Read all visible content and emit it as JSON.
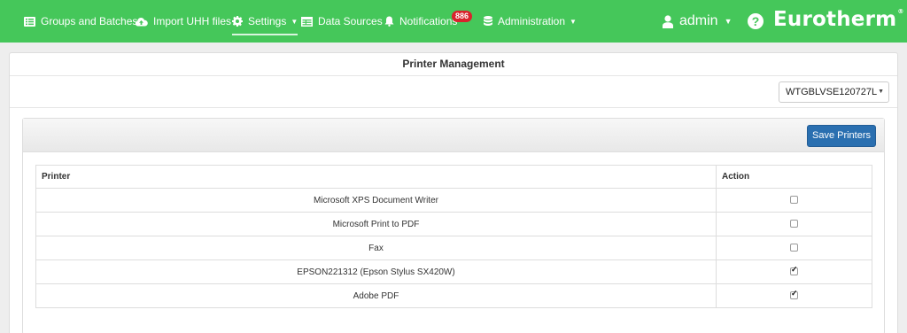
{
  "nav": {
    "groups_batches": "Groups and Batches",
    "import_uhh": "Import UHH files",
    "settings": "Settings",
    "data_sources": "Data Sources",
    "notifications": "Notifications",
    "notifications_count": "886",
    "administration": "Administration",
    "user": "admin",
    "help": "?",
    "brand": "Eurotherm",
    "brand_reg": "®"
  },
  "colors": {
    "navbar": "#45c75a",
    "primary_button": "#2a6fb0",
    "badge": "#d9232d"
  },
  "page": {
    "title": "Printer Management",
    "server_select": "WTGBLVSE120727L",
    "save_button": "Save Printers"
  },
  "table": {
    "headers": [
      "Printer",
      "Action"
    ],
    "rows": [
      {
        "printer": "Microsoft XPS Document Writer",
        "checked": false
      },
      {
        "printer": "Microsoft Print to PDF",
        "checked": false
      },
      {
        "printer": "Fax",
        "checked": false
      },
      {
        "printer": "EPSON221312 (Epson Stylus SX420W)",
        "checked": true
      },
      {
        "printer": "Adobe PDF",
        "checked": true
      }
    ]
  }
}
